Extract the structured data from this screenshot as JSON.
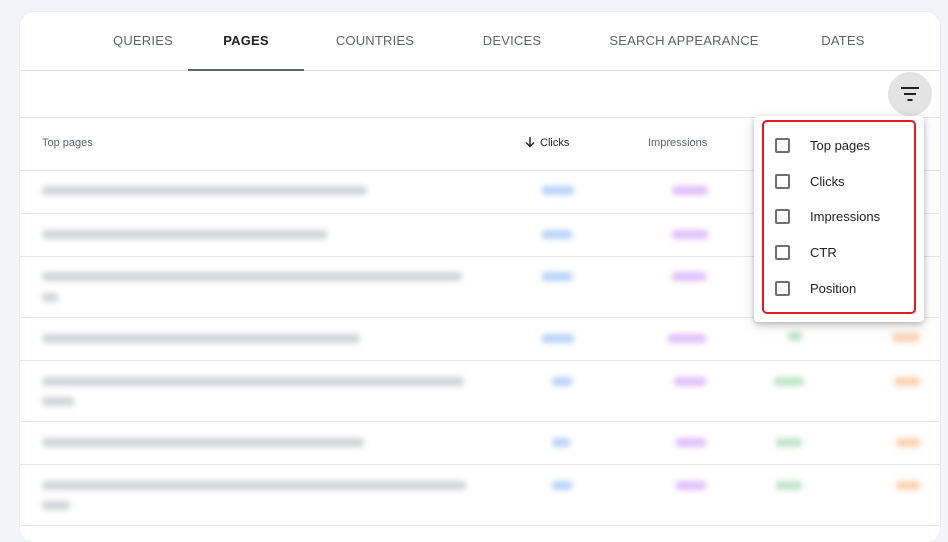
{
  "tabs": [
    {
      "label": "QUERIES",
      "active": false
    },
    {
      "label": "PAGES",
      "active": true
    },
    {
      "label": "COUNTRIES",
      "active": false
    },
    {
      "label": "DEVICES",
      "active": false
    },
    {
      "label": "SEARCH APPEARANCE",
      "active": false
    },
    {
      "label": "DATES",
      "active": false
    }
  ],
  "toolbar": {
    "filter_icon": "filter-list-icon"
  },
  "table": {
    "columns": {
      "top_pages": "Top pages",
      "clicks": "Clicks",
      "impressions": "Impressions"
    },
    "sort_icon": "arrow-down-icon",
    "rows_blurred": true
  },
  "column_menu": {
    "items": [
      {
        "label": "Top pages",
        "checked": false
      },
      {
        "label": "Clicks",
        "checked": false
      },
      {
        "label": "Impressions",
        "checked": false
      },
      {
        "label": "CTR",
        "checked": false
      },
      {
        "label": "Position",
        "checked": false
      }
    ],
    "highlight_color": "#e01b24"
  },
  "colors": {
    "background": "#f2f4fb",
    "card": "#ffffff",
    "clicks": "#8ab4f8",
    "impressions": "#c58af9",
    "ctr": "#81c995",
    "position": "#f6ae73"
  }
}
